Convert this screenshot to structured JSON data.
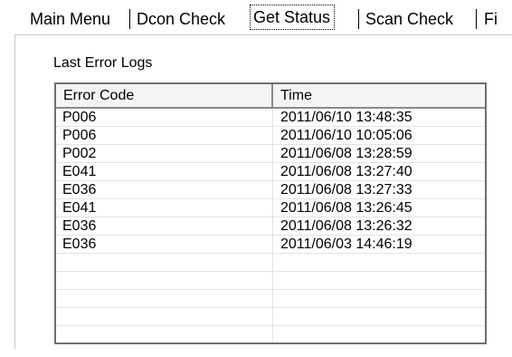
{
  "tabs": [
    {
      "label": "Main Menu",
      "active": false
    },
    {
      "label": "Dcon Check",
      "active": false
    },
    {
      "label": "Get Status",
      "active": true
    },
    {
      "label": "Scan Check",
      "active": false
    },
    {
      "label": "Fi",
      "active": false
    }
  ],
  "panel": {
    "title": "Last Error Logs"
  },
  "error_log": {
    "columns": [
      "Error Code",
      "Time"
    ],
    "rows": [
      {
        "code": "P006",
        "time": "2011/06/10 13:48:35"
      },
      {
        "code": "P006",
        "time": "2011/06/10 10:05:06"
      },
      {
        "code": "P002",
        "time": "2011/06/08 13:28:59"
      },
      {
        "code": "E041",
        "time": "2011/06/08 13:27:40"
      },
      {
        "code": "E036",
        "time": "2011/06/08 13:27:33"
      },
      {
        "code": "E041",
        "time": "2011/06/08 13:26:45"
      },
      {
        "code": "E036",
        "time": "2011/06/08 13:26:32"
      },
      {
        "code": "E036",
        "time": "2011/06/03 14:46:19"
      }
    ]
  }
}
